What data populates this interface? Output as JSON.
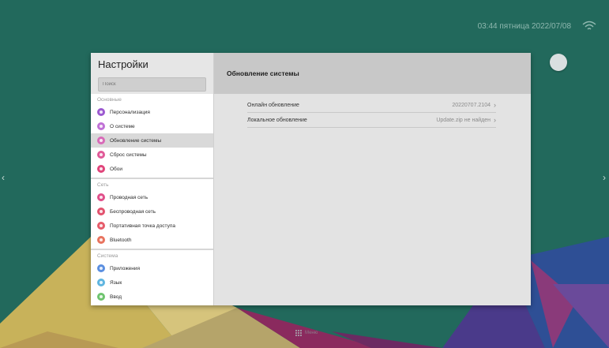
{
  "status": {
    "datetime": "03:44 пятница 2022/07/08",
    "wifi_icon": "wifi-icon"
  },
  "sidebar": {
    "title": "Настройки",
    "search_placeholder": "Поиск",
    "groups": [
      {
        "title": "Основные",
        "items": [
          {
            "label": "Персонализация",
            "color": "#9b59d0"
          },
          {
            "label": "О системе",
            "color": "#c071d6"
          },
          {
            "label": "Обновление системы",
            "color": "#d86ab8",
            "active": true
          },
          {
            "label": "Сброс системы",
            "color": "#e05a98"
          },
          {
            "label": "Обои",
            "color": "#e0447a"
          }
        ]
      },
      {
        "title": "Сеть",
        "items": [
          {
            "label": "Проводная сеть",
            "color": "#e0508a"
          },
          {
            "label": "Беспроводная сеть",
            "color": "#e2526e"
          },
          {
            "label": "Портативная точка доступа",
            "color": "#e65c6a"
          },
          {
            "label": "Bluetooth",
            "color": "#e8735e"
          }
        ]
      },
      {
        "title": "Система",
        "items": [
          {
            "label": "Приложения",
            "color": "#5b8fe0"
          },
          {
            "label": "Язык",
            "color": "#5fb5e0"
          },
          {
            "label": "Ввод",
            "color": "#6ec46e"
          }
        ]
      }
    ]
  },
  "content": {
    "title": "Обновление системы",
    "rows": [
      {
        "label": "Онлайн обновление",
        "value": "20220707.2104"
      },
      {
        "label": "Локальное обновление",
        "value": "Update.zip не найден"
      }
    ]
  },
  "dock": {
    "label": "Меню"
  },
  "colors": {
    "wallpaper": "#22695c",
    "window": "#e3e3e3",
    "sidebar": "#ffffff",
    "header": "#c8c8c8"
  }
}
